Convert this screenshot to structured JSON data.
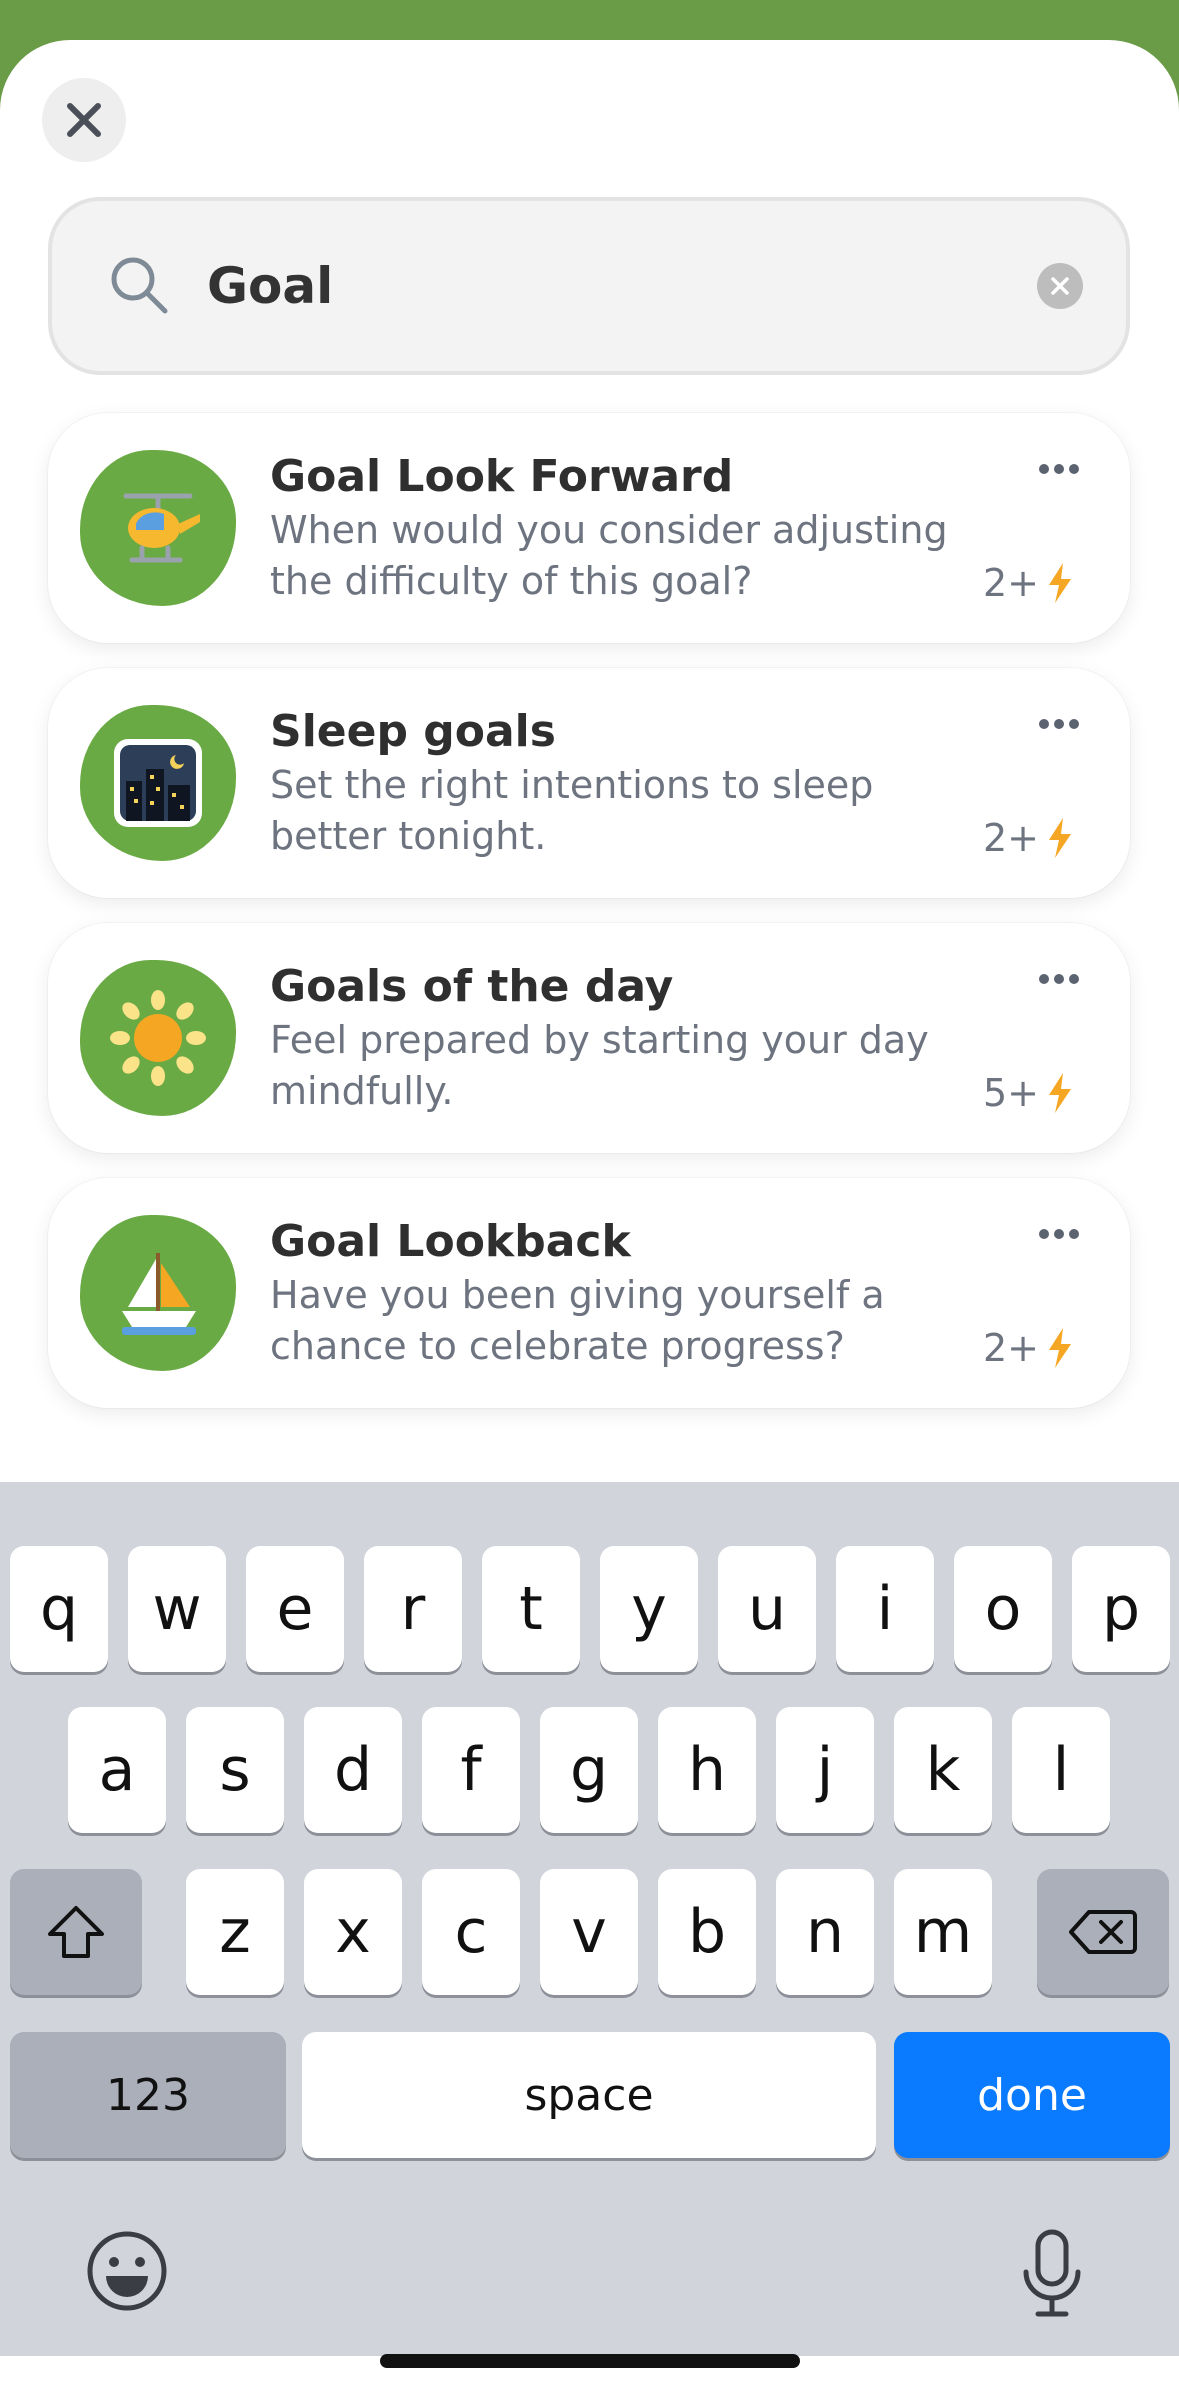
{
  "search": {
    "value": "Goal",
    "placeholder": ""
  },
  "results": [
    {
      "title": "Goal Look Forward",
      "description": "When would you consider adjusting the difficulty of this goal?",
      "count": "2+",
      "icon": "helicopter-icon"
    },
    {
      "title": "Sleep goals",
      "description": "Set the right intentions to sleep better tonight.",
      "count": "2+",
      "icon": "night-city-icon"
    },
    {
      "title": "Goals of the day",
      "description": "Feel prepared by starting your day mindfully.",
      "count": "5+",
      "icon": "sun-icon"
    },
    {
      "title": "Goal Lookback",
      "description": "Have you been giving yourself a chance to celebrate progress?",
      "count": "2+",
      "icon": "sailboat-icon"
    }
  ],
  "keyboard": {
    "row1": [
      "q",
      "w",
      "e",
      "r",
      "t",
      "y",
      "u",
      "i",
      "o",
      "p"
    ],
    "row2": [
      "a",
      "s",
      "d",
      "f",
      "g",
      "h",
      "j",
      "k",
      "l"
    ],
    "row3": [
      "z",
      "x",
      "c",
      "v",
      "b",
      "n",
      "m"
    ],
    "numbers_label": "123",
    "space_label": "space",
    "done_label": "done"
  },
  "colors": {
    "brand_green": "#6a9c47",
    "thumb_green": "#6aaa44",
    "accent_blue": "#0a7bff",
    "bolt": "#f5a623"
  }
}
